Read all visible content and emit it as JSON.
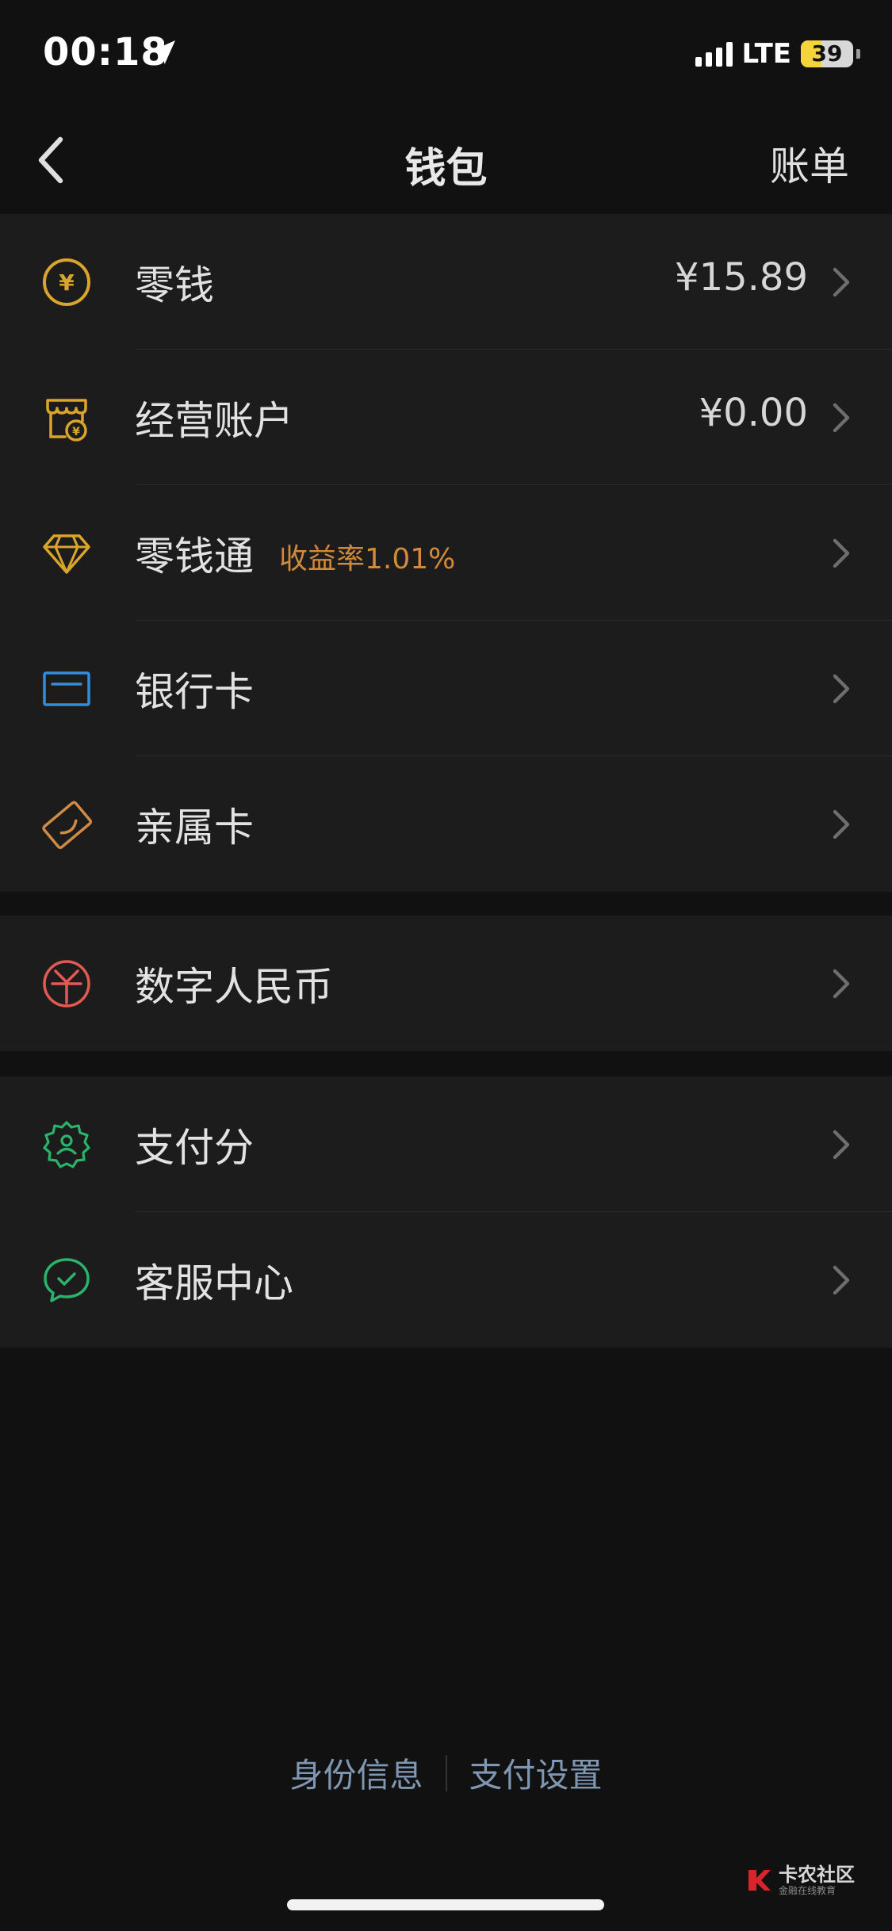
{
  "status_bar": {
    "time": "00:18",
    "network": "LTE",
    "battery": "39",
    "battery_level": 0.39
  },
  "nav": {
    "title": "钱包",
    "action": "账单"
  },
  "groups": [
    {
      "items": [
        {
          "label": "零钱",
          "value": "¥15.89",
          "icon": "yuan-coin-icon",
          "color": "#d9a52b"
        },
        {
          "label": "经营账户",
          "value": "¥0.00",
          "icon": "shop-account-icon",
          "color": "#d9a52b"
        },
        {
          "label": "零钱通",
          "badge": "收益率1.01%",
          "icon": "diamond-icon",
          "color": "#d9a52b"
        },
        {
          "label": "银行卡",
          "icon": "bank-card-icon",
          "color": "#2f8ee0"
        },
        {
          "label": "亲属卡",
          "icon": "family-card-icon",
          "color": "#d08a45"
        }
      ]
    },
    {
      "items": [
        {
          "label": "数字人民币",
          "icon": "digital-rmb-icon",
          "color": "#e25a52"
        }
      ]
    },
    {
      "items": [
        {
          "label": "支付分",
          "icon": "pay-score-icon",
          "color": "#2bb36b"
        },
        {
          "label": "客服中心",
          "icon": "customer-service-icon",
          "color": "#2bb36b"
        }
      ]
    }
  ],
  "footer": {
    "link_identity": "身份信息",
    "link_settings": "支付设置"
  },
  "watermark": {
    "main": "卡农社区",
    "sub": "金融在线教育"
  }
}
